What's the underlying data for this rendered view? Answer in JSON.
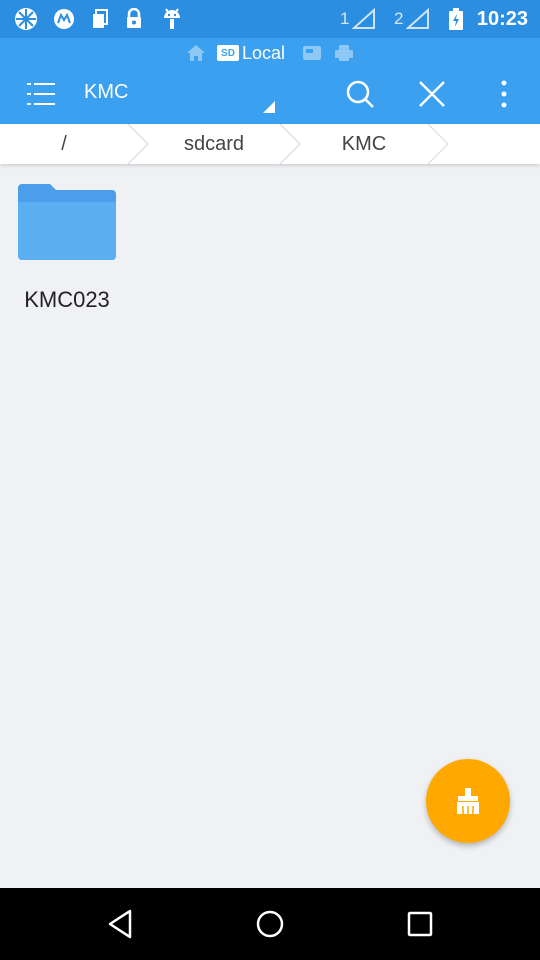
{
  "status_bar": {
    "time": "10:23",
    "sim1_label": "1",
    "sim2_label": "2",
    "left_icons": [
      "pinwheel-icon",
      "motorola-icon",
      "doc-icon",
      "lock-icon",
      "android-icon"
    ]
  },
  "app_bar": {
    "storage_label": "Local",
    "storage_chip_text": "SD",
    "title": "KMC",
    "icons": [
      "menu-icon",
      "search-icon",
      "close-icon",
      "more-vert-icon"
    ]
  },
  "breadcrumb": {
    "items": [
      "/",
      "sdcard",
      "KMC"
    ]
  },
  "files": [
    {
      "name": "KMC023",
      "type": "folder"
    }
  ],
  "fab": {
    "icon": "broom-icon"
  },
  "nav_bar": {
    "icons": [
      "back-icon",
      "home-icon",
      "recents-icon"
    ]
  },
  "colors": {
    "status_bar": "#2b8ee0",
    "app_bar": "#3aa0ef",
    "background": "#f0f1f4",
    "folder": "#5aaef2",
    "fab": "#ffa800"
  }
}
